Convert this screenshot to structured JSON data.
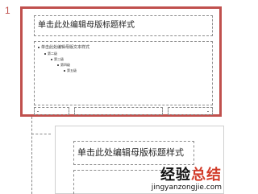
{
  "slide_number": "1",
  "master_thumb": {
    "title": "单击此处编辑母版标题样式",
    "body_levels": [
      "单击此处编辑母版文本样式",
      "第二级",
      "第三级",
      "第四级",
      "第五级"
    ]
  },
  "layout_thumb": {
    "title": "单击此处编辑母版标题样式"
  },
  "watermark": {
    "text_a": "经验",
    "text_b": "总结",
    "url": "jingyanzongjie.com"
  },
  "colors": {
    "selection": "#c0504d",
    "watermark_accent": "#d23c2a"
  }
}
